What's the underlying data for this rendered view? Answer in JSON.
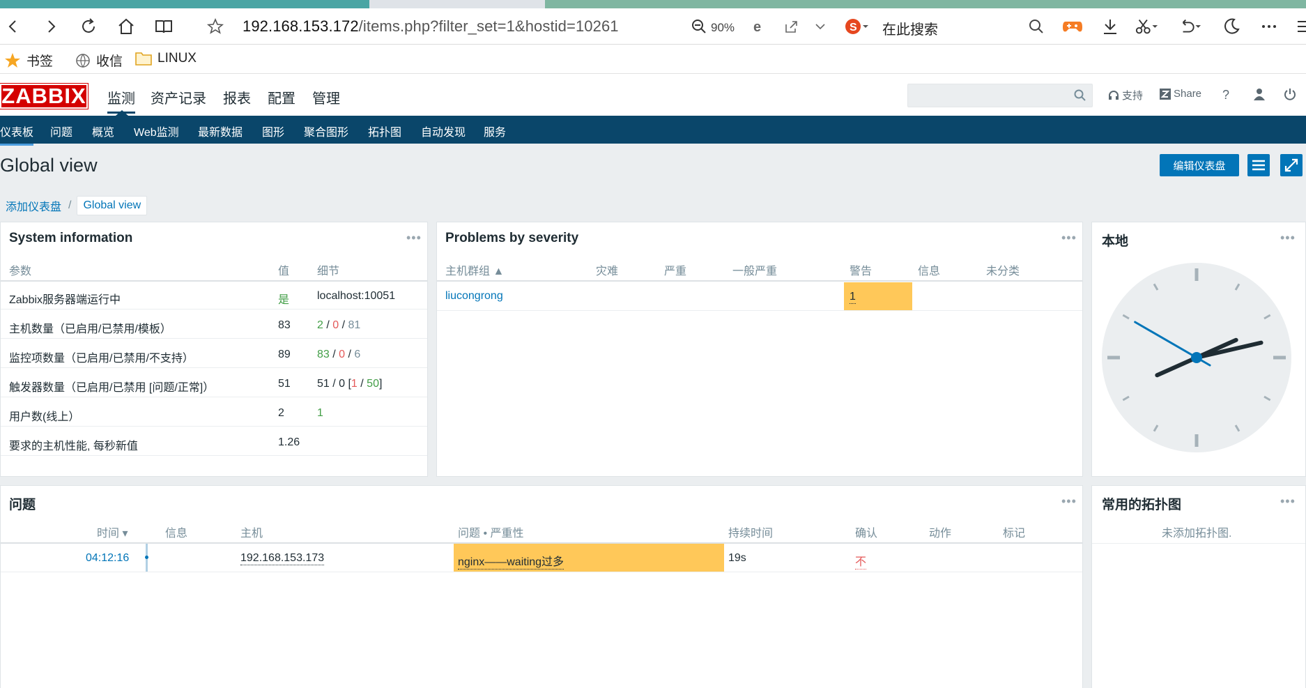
{
  "browser": {
    "url_host": "192.168.153.172",
    "url_path": "/items.php?filter_set=1&hostid=10261",
    "zoom": "90%",
    "search_placeholder": "在此搜索",
    "bookmarks": [
      "书签",
      "收信",
      "LINUX"
    ]
  },
  "header": {
    "logo": "ZABBIX",
    "menu": [
      "监测",
      "资产记录",
      "报表",
      "配置",
      "管理"
    ],
    "support": "支持",
    "share": "Share",
    "help": "?"
  },
  "subnav": [
    "仪表板",
    "问题",
    "概览",
    "Web监测",
    "最新数据",
    "图形",
    "聚合图形",
    "拓扑图",
    "自动发现",
    "服务"
  ],
  "page": {
    "title": "Global view",
    "edit_button": "编辑仪表盘",
    "breadcrumb": [
      "添加仪表盘",
      "/",
      "Global view"
    ]
  },
  "sysinfo": {
    "title": "System information",
    "headers": [
      "参数",
      "值",
      "细节"
    ],
    "rows": [
      {
        "param": "Zabbix服务器端运行中",
        "value": "是",
        "d1": "localhost:10051",
        "d2": "",
        "d3": "",
        "d4": "",
        "d5": "",
        "d6": "",
        "d7": "",
        "d8": "",
        "d9": ""
      },
      {
        "param": "主机数量（已启用/已禁用/模板）",
        "value": "83",
        "d1": "",
        "d2": "2",
        "d3": " / ",
        "d4": "0",
        "d5": " / ",
        "d6": "81",
        "d7": "",
        "d8": "",
        "d9": ""
      },
      {
        "param": "监控项数量（已启用/已禁用/不支持）",
        "value": "89",
        "d1": "",
        "d2": "83",
        "d3": " / ",
        "d4": "0",
        "d5": " / ",
        "d6": "6",
        "d7": "",
        "d8": "",
        "d9": ""
      },
      {
        "param": "触发器数量（已启用/已禁用 [问题/正常]）",
        "value": "51",
        "d1": "51 / 0 [",
        "d2": "",
        "d3": "",
        "d4": "1",
        "d5": " / ",
        "d6": "",
        "d7": "50",
        "d8": "]",
        "d9": ""
      },
      {
        "param": "用户数(线上）",
        "value": "2",
        "d1": "",
        "d2": "1",
        "d3": "",
        "d4": "",
        "d5": "",
        "d6": "",
        "d7": "",
        "d8": "",
        "d9": ""
      },
      {
        "param": "要求的主机性能, 每秒新值",
        "value": "1.26",
        "d1": "",
        "d2": "",
        "d3": "",
        "d4": "",
        "d5": "",
        "d6": "",
        "d7": "",
        "d8": "",
        "d9": ""
      }
    ]
  },
  "severity": {
    "title": "Problems by severity",
    "headers": [
      "主机群组 ▲",
      "灾难",
      "严重",
      "一般严重",
      "警告",
      "信息",
      "未分类"
    ],
    "group": "liucongrong",
    "warning_count": "1",
    "warning_color": "#ffc859"
  },
  "clock": {
    "title": "本地",
    "hour": 2,
    "minute": 12,
    "second": 50
  },
  "problems": {
    "title": "问题",
    "headers": [
      "时间 ▾",
      "信息",
      "主机",
      "问题 • 严重性",
      "持续时间",
      "确认",
      "动作",
      "标记"
    ],
    "row": {
      "time": "04:12:16",
      "host": "192.168.153.173",
      "problem": "nginx——waiting过多",
      "duration": "19s",
      "ack": "不"
    }
  },
  "maps": {
    "title": "常用的拓扑图",
    "empty": "未添加拓扑图."
  }
}
